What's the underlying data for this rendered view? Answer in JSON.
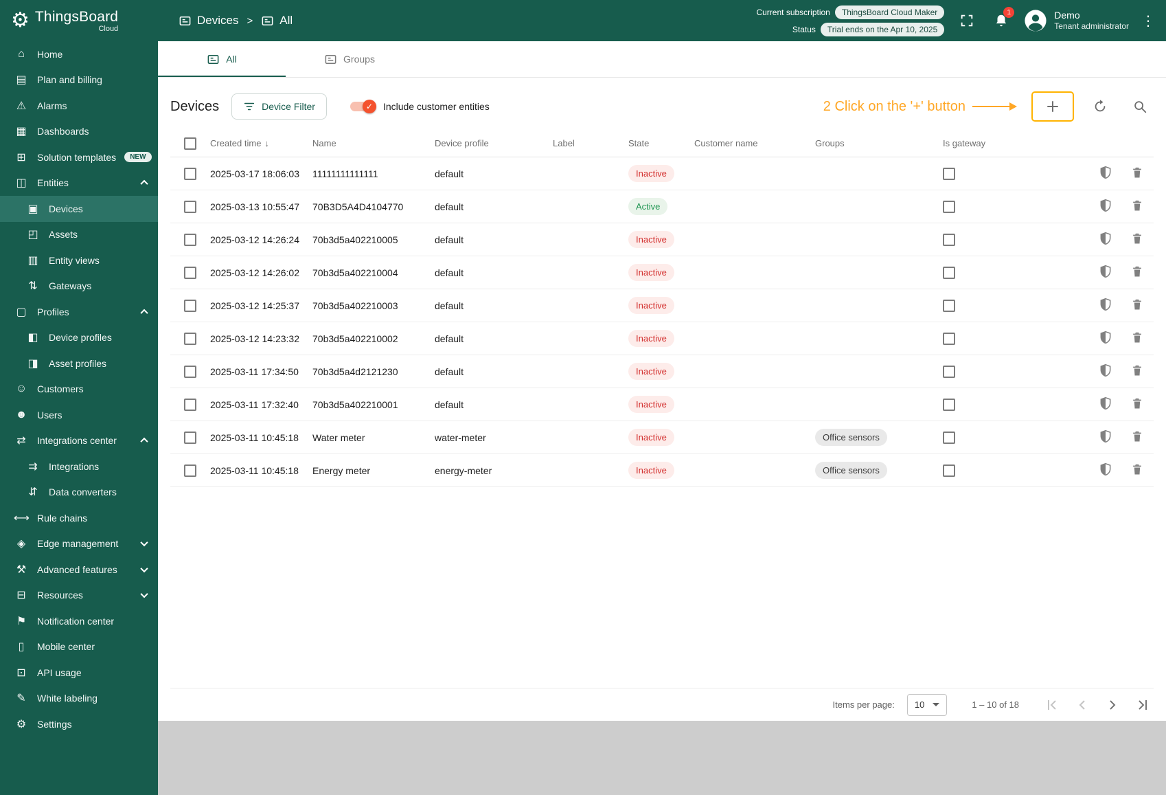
{
  "app": {
    "logo_title": "ThingsBoard",
    "logo_subtitle": "Cloud"
  },
  "header": {
    "breadcrumb": [
      {
        "label": "Devices"
      },
      {
        "label": "All"
      }
    ],
    "separator": ">",
    "subscription": {
      "label": "Current subscription",
      "value": "ThingsBoard Cloud Maker"
    },
    "status": {
      "label": "Status",
      "value": "Trial ends on the Apr 10, 2025"
    },
    "notifications": {
      "count": "1"
    },
    "user": {
      "name": "Demo",
      "role": "Tenant administrator"
    }
  },
  "sidebar": {
    "items": [
      {
        "name": "sidebar-item-home",
        "icon_name": "home-icon",
        "glyph": "⌂",
        "label": "Home"
      },
      {
        "name": "sidebar-item-plan-and-billing",
        "icon_name": "billing-icon",
        "glyph": "▤",
        "label": "Plan and billing"
      },
      {
        "name": "sidebar-item-alarms",
        "icon_name": "alarm-icon",
        "glyph": "⚠",
        "label": "Alarms"
      },
      {
        "name": "sidebar-item-dashboards",
        "icon_name": "dashboards-icon",
        "glyph": "▦",
        "label": "Dashboards"
      },
      {
        "name": "sidebar-item-solution-templates",
        "icon_name": "solution-templates-icon",
        "glyph": "⊞",
        "label": "Solution templates",
        "badge": "NEW"
      },
      {
        "name": "sidebar-item-entities",
        "icon_name": "entities-icon",
        "glyph": "◫",
        "label": "Entities",
        "chevron": "up"
      },
      {
        "name": "sidebar-item-devices",
        "icon_name": "devices-icon",
        "glyph": "▣",
        "label": "Devices",
        "cls": "sub selected"
      },
      {
        "name": "sidebar-item-assets",
        "icon_name": "assets-icon",
        "glyph": "◰",
        "label": "Assets",
        "cls": "sub"
      },
      {
        "name": "sidebar-item-entity-views",
        "icon_name": "entity-views-icon",
        "glyph": "▥",
        "label": "Entity views",
        "cls": "sub"
      },
      {
        "name": "sidebar-item-gateways",
        "icon_name": "gateways-icon",
        "glyph": "⇅",
        "label": "Gateways",
        "cls": "sub"
      },
      {
        "name": "sidebar-item-profiles",
        "icon_name": "profiles-icon",
        "glyph": "▢",
        "label": "Profiles",
        "chevron": "up"
      },
      {
        "name": "sidebar-item-device-profiles",
        "icon_name": "device-profiles-icon",
        "glyph": "◧",
        "label": "Device profiles",
        "cls": "sub"
      },
      {
        "name": "sidebar-item-asset-profiles",
        "icon_name": "asset-profiles-icon",
        "glyph": "◨",
        "label": "Asset profiles",
        "cls": "sub"
      },
      {
        "name": "sidebar-item-customers",
        "icon_name": "customers-icon",
        "glyph": "☺",
        "label": "Customers"
      },
      {
        "name": "sidebar-item-users",
        "icon_name": "users-icon",
        "glyph": "☻",
        "label": "Users"
      },
      {
        "name": "sidebar-item-integrations-center",
        "icon_name": "integrations-center-icon",
        "glyph": "⇄",
        "label": "Integrations center",
        "chevron": "up"
      },
      {
        "name": "sidebar-item-integrations",
        "icon_name": "integrations-icon",
        "glyph": "⇉",
        "label": "Integrations",
        "cls": "sub"
      },
      {
        "name": "sidebar-item-data-converters",
        "icon_name": "data-converters-icon",
        "glyph": "⇵",
        "label": "Data converters",
        "cls": "sub"
      },
      {
        "name": "sidebar-item-rule-chains",
        "icon_name": "rule-chains-icon",
        "glyph": "⟷",
        "label": "Rule chains"
      },
      {
        "name": "sidebar-item-edge-management",
        "icon_name": "edge-management-icon",
        "glyph": "◈",
        "label": "Edge management",
        "chevron": "down"
      },
      {
        "name": "sidebar-item-advanced-features",
        "icon_name": "advanced-features-icon",
        "glyph": "⚒",
        "label": "Advanced features",
        "chevron": "down"
      },
      {
        "name": "sidebar-item-resources",
        "icon_name": "resources-icon",
        "glyph": "⊟",
        "label": "Resources",
        "chevron": "down"
      },
      {
        "name": "sidebar-item-notification-center",
        "icon_name": "notification-center-icon",
        "glyph": "⚑",
        "label": "Notification center"
      },
      {
        "name": "sidebar-item-mobile-center",
        "icon_name": "mobile-center-icon",
        "glyph": "▯",
        "label": "Mobile center"
      },
      {
        "name": "sidebar-item-api-usage",
        "icon_name": "api-usage-icon",
        "glyph": "⊡",
        "label": "API usage"
      },
      {
        "name": "sidebar-item-white-labeling",
        "icon_name": "white-labeling-icon",
        "glyph": "✎",
        "label": "White labeling"
      },
      {
        "name": "sidebar-item-settings",
        "icon_name": "settings-icon",
        "glyph": "⚙",
        "label": "Settings"
      }
    ]
  },
  "tabs": [
    {
      "label": "All"
    },
    {
      "label": "Groups"
    }
  ],
  "toolbar": {
    "title": "Devices",
    "filter_button": "Device Filter",
    "toggle_label": "Include customer entities",
    "toggle_on": true
  },
  "annotation": {
    "text": "2 Click on the '+' button",
    "color": "#FFA726"
  },
  "table": {
    "columns": [
      "Created time",
      "Name",
      "Device profile",
      "Label",
      "State",
      "Customer name",
      "Groups",
      "Is gateway"
    ],
    "sort_arrow": "↓",
    "rows": [
      {
        "created": "2025-03-17 18:06:03",
        "name": "11111111111111",
        "profile": "default",
        "label": "",
        "state": "Inactive",
        "state_cls": "inactive",
        "customer": "",
        "group": ""
      },
      {
        "created": "2025-03-13 10:55:47",
        "name": "70B3D5A4D4104770",
        "profile": "default",
        "label": "",
        "state": "Active",
        "state_cls": "active",
        "customer": "",
        "group": ""
      },
      {
        "created": "2025-03-12 14:26:24",
        "name": "70b3d5a402210005",
        "profile": "default",
        "label": "",
        "state": "Inactive",
        "state_cls": "inactive",
        "customer": "",
        "group": ""
      },
      {
        "created": "2025-03-12 14:26:02",
        "name": "70b3d5a402210004",
        "profile": "default",
        "label": "",
        "state": "Inactive",
        "state_cls": "inactive",
        "customer": "",
        "group": ""
      },
      {
        "created": "2025-03-12 14:25:37",
        "name": "70b3d5a402210003",
        "profile": "default",
        "label": "",
        "state": "Inactive",
        "state_cls": "inactive",
        "customer": "",
        "group": ""
      },
      {
        "created": "2025-03-12 14:23:32",
        "name": "70b3d5a402210002",
        "profile": "default",
        "label": "",
        "state": "Inactive",
        "state_cls": "inactive",
        "customer": "",
        "group": ""
      },
      {
        "created": "2025-03-11 17:34:50",
        "name": "70b3d5a4d2121230",
        "profile": "default",
        "label": "",
        "state": "Inactive",
        "state_cls": "inactive",
        "customer": "",
        "group": ""
      },
      {
        "created": "2025-03-11 17:32:40",
        "name": "70b3d5a402210001",
        "profile": "default",
        "label": "",
        "state": "Inactive",
        "state_cls": "inactive",
        "customer": "",
        "group": ""
      },
      {
        "created": "2025-03-11 10:45:18",
        "name": "Water meter",
        "profile": "water-meter",
        "label": "",
        "state": "Inactive",
        "state_cls": "inactive",
        "customer": "",
        "group": "Office sensors"
      },
      {
        "created": "2025-03-11 10:45:18",
        "name": "Energy meter",
        "profile": "energy-meter",
        "label": "",
        "state": "Inactive",
        "state_cls": "inactive",
        "customer": "",
        "group": "Office sensors"
      }
    ]
  },
  "pagination": {
    "items_per_page_label": "Items per page:",
    "items_per_page": "10",
    "range": "1 – 10 of 18"
  },
  "colors": {
    "primary": "#175C4D",
    "accent": "#F4522E",
    "annotation": "#FFA726",
    "inactive_text": "#D3302F",
    "active_text": "#219653"
  }
}
